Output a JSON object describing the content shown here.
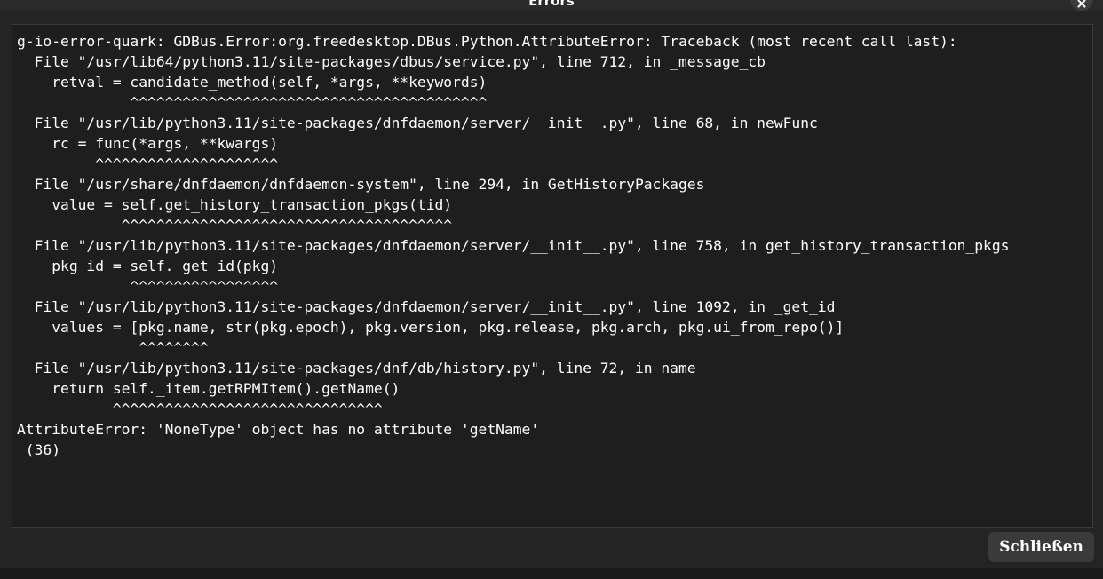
{
  "window": {
    "title": "Errors",
    "close_icon": "close-icon"
  },
  "error": {
    "text": "g-io-error-quark: GDBus.Error:org.freedesktop.DBus.Python.AttributeError: Traceback (most recent call last):\n  File \"/usr/lib64/python3.11/site-packages/dbus/service.py\", line 712, in _message_cb\n    retval = candidate_method(self, *args, **keywords)\n             ^^^^^^^^^^^^^^^^^^^^^^^^^^^^^^^^^^^^^^^^^\n  File \"/usr/lib/python3.11/site-packages/dnfdaemon/server/__init__.py\", line 68, in newFunc\n    rc = func(*args, **kwargs)\n         ^^^^^^^^^^^^^^^^^^^^^\n  File \"/usr/share/dnfdaemon/dnfdaemon-system\", line 294, in GetHistoryPackages\n    value = self.get_history_transaction_pkgs(tid)\n            ^^^^^^^^^^^^^^^^^^^^^^^^^^^^^^^^^^^^^^\n  File \"/usr/lib/python3.11/site-packages/dnfdaemon/server/__init__.py\", line 758, in get_history_transaction_pkgs\n    pkg_id = self._get_id(pkg)\n             ^^^^^^^^^^^^^^^^^\n  File \"/usr/lib/python3.11/site-packages/dnfdaemon/server/__init__.py\", line 1092, in _get_id\n    values = [pkg.name, str(pkg.epoch), pkg.version, pkg.release, pkg.arch, pkg.ui_from_repo()]\n              ^^^^^^^^\n  File \"/usr/lib/python3.11/site-packages/dnf/db/history.py\", line 72, in name\n    return self._item.getRPMItem().getName()\n           ^^^^^^^^^^^^^^^^^^^^^^^^^^^^^^^\nAttributeError: 'NoneType' object has no attribute 'getName'\n (36)"
  },
  "footer": {
    "close_label": "Schließen"
  }
}
